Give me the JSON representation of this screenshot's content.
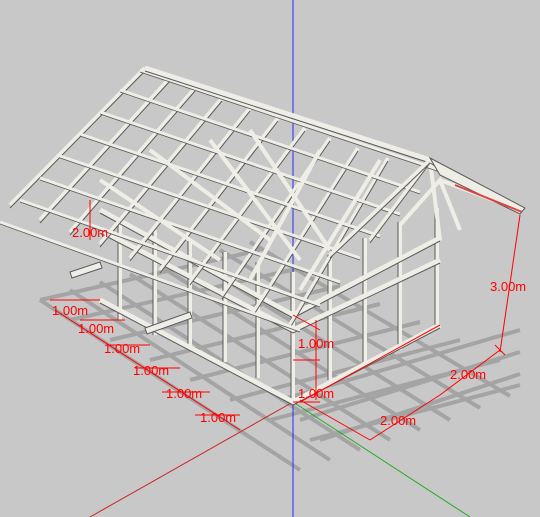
{
  "colors": {
    "background": "#c8c8c8",
    "dimension": "#ff0000",
    "axis_blue": "#2a2aff",
    "axis_red": "#cc2222",
    "axis_green": "#22aa22",
    "timber": "#efeee6",
    "timber_edge": "#5a5a5a",
    "shadow": "#9c9c9c"
  },
  "dimensions": {
    "left_front": [
      "1.00m",
      "1.00m",
      "1.00m",
      "1.00m",
      "1.00m",
      "1.00m"
    ],
    "left_height": "2.00m",
    "center_upper": "1.00m",
    "center_lower": "1.00m",
    "right_depth_a": "2.00m",
    "right_depth_b": "2.00m",
    "right_height": "3.00m"
  },
  "icons": {
    "model": "timber-frame-model",
    "axes": "model-axes"
  }
}
